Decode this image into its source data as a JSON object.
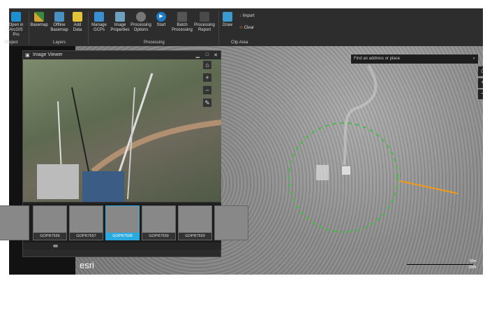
{
  "ribbon": {
    "buttons": [
      {
        "label": "Open in ArcGIS Pro",
        "color": "#1e8fcf"
      },
      {
        "label": "Basemap",
        "color": "#d8a431"
      },
      {
        "label": "Offline Basemap",
        "color": "#4a90c0"
      },
      {
        "label": "Add Data",
        "color": "#e3c33a"
      },
      {
        "label": "Manage GCPs",
        "color": "#3a8fd0"
      },
      {
        "label": "Image Properties",
        "color": "#6fa0c0"
      },
      {
        "label": "Processing Options",
        "color": "#777777"
      },
      {
        "label": "Start",
        "color": "#1e7bc4"
      },
      {
        "label": "Batch Processing",
        "color": "#555555"
      },
      {
        "label": "Processing Report",
        "color": "#4a4a4a"
      },
      {
        "label": "Draw",
        "color": "#3a9ad0"
      }
    ],
    "small": {
      "import": "Import",
      "clear": "Clear"
    },
    "groups": {
      "project": "Project",
      "layers": "Layers",
      "processing": "Processing",
      "clip": "Clip Area"
    }
  },
  "map": {
    "search_placeholder": "Find an address or place",
    "logo": "esri",
    "scale": {
      "metric": "50m",
      "imperial": "100ft"
    },
    "circle_color": "#3fbf3f",
    "marker_color": "#3fbf3f",
    "line_color": "#f39c12"
  },
  "viewer": {
    "title": "Image Viewer",
    "thumbnails": [
      "GOPR7556",
      "GOPR7557",
      "GOPR7558",
      "GOPR7559",
      "GOPR7560"
    ],
    "selected": "GOPR7558",
    "accent": "#29abe2"
  }
}
